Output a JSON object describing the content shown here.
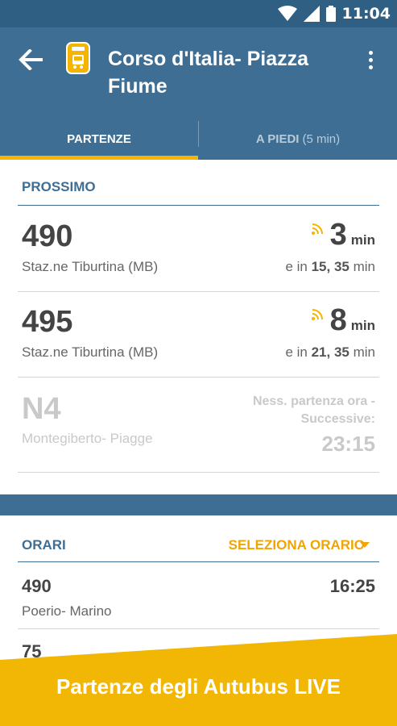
{
  "status_bar": {
    "time": "11:04"
  },
  "app_bar": {
    "title": "Corso d'Italia- Piazza Fiume",
    "tabs": [
      {
        "label": "PARTENZE",
        "active": true
      },
      {
        "label": "A PIEDI",
        "sub": "(5 min)",
        "active": false
      }
    ]
  },
  "departures": {
    "section_title": "PROSSIMO",
    "rows": [
      {
        "route": "490",
        "destination": "Staz.ne Tiburtina (MB)",
        "minutes": "3",
        "unit": "min",
        "next_prefix": "e in",
        "next_values": "15, 35",
        "next_unit": "min",
        "live": true
      },
      {
        "route": "495",
        "destination": "Staz.ne Tiburtina (MB)",
        "minutes": "8",
        "unit": "min",
        "next_prefix": "e in",
        "next_values": "21, 35",
        "next_unit": "min",
        "live": true
      },
      {
        "route": "N4",
        "destination": "Montegiberto- Piagge",
        "none_line1": "Ness. partenza ora -",
        "none_line2": "Successive:",
        "next_time": "23:15",
        "live": false
      }
    ]
  },
  "schedule": {
    "section_title": "ORARI",
    "select_label": "SELEZIONA ORARIO",
    "rows": [
      {
        "route": "490",
        "destination": "Poerio- Marino",
        "time": "16:25"
      },
      {
        "route": "75"
      }
    ]
  },
  "promo": {
    "text": "Partenze degli Autubus LIVE"
  },
  "colors": {
    "primary": "#3e6e93",
    "accent": "#f5b400",
    "status_bar": "#2f5f82"
  }
}
